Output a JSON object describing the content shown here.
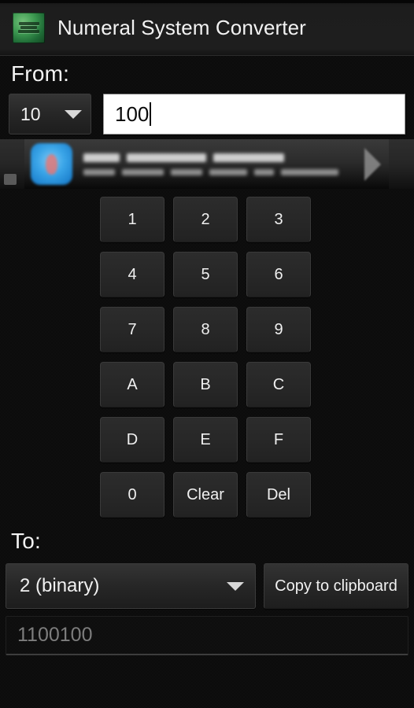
{
  "titlebar": {
    "icon_name": "app-logo-icon",
    "title": "Numeral System Converter"
  },
  "from": {
    "label": "From:",
    "base_value": "10",
    "input_value": "100",
    "caret_icon": "chevron-down-icon"
  },
  "ad": {
    "icon_name": "ad-app-icon",
    "info_icon": "ad-info-icon",
    "chevron_icon": "chevron-right-icon"
  },
  "keypad": {
    "keys": [
      "1",
      "2",
      "3",
      "4",
      "5",
      "6",
      "7",
      "8",
      "9",
      "A",
      "B",
      "C",
      "D",
      "E",
      "F",
      "0",
      "Clear",
      "Del"
    ]
  },
  "to": {
    "label": "To:",
    "base_value": "2 (binary)",
    "copy_label": "Copy to clipboard",
    "result_value": "1100100",
    "caret_icon": "chevron-down-icon"
  },
  "colors": {
    "background": "#0c0c0c",
    "titlebar": "#1e1e1e",
    "key_face": "#272727",
    "text_primary": "#f0f0f0",
    "text_muted": "#7d7d7d",
    "input_background": "#ffffff",
    "accent_green": "#3e9a52"
  }
}
